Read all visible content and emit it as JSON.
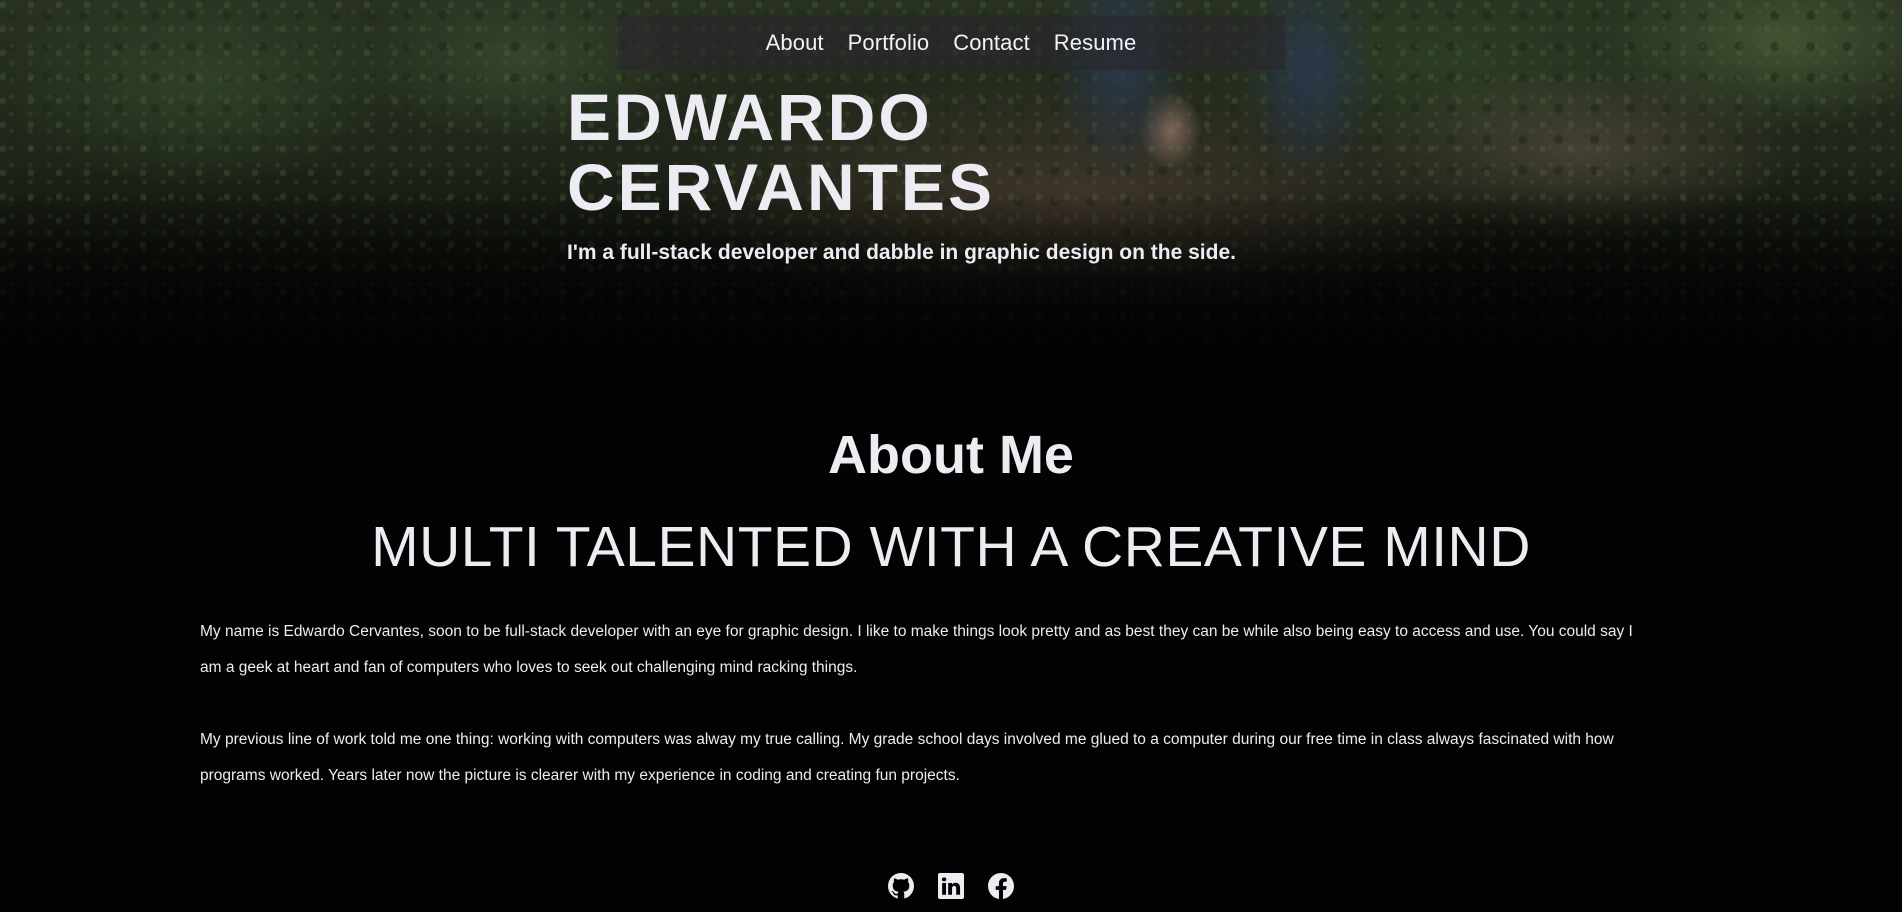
{
  "nav": {
    "items": [
      {
        "label": "About"
      },
      {
        "label": "Portfolio"
      },
      {
        "label": "Contact"
      },
      {
        "label": "Resume"
      }
    ]
  },
  "hero": {
    "title_line1": "EDWARDO",
    "title_line2": "CERVANTES",
    "subtitle": "I'm a full-stack developer and dabble in graphic design on the side."
  },
  "about": {
    "heading": "About Me",
    "tagline": "MULTI TALENTED WITH A CREATIVE MIND",
    "paragraphs": [
      "My name is Edwardo Cervantes, soon to be full-stack developer with an eye for graphic design. I like to make things look pretty and as best they can be while also being easy to access and use. You could say I am a geek at heart and fan of computers who loves to seek out challenging mind racking things.",
      "My previous line of work told me one thing: working with computers was alway my true calling. My grade school days involved me glued to a computer during our free time in class always fascinated with how programs worked. Years later now the picture is clearer with my experience in coding and creating fun projects."
    ]
  },
  "social": {
    "icons": [
      "github-icon",
      "linkedin-icon",
      "facebook-icon"
    ]
  },
  "colors": {
    "background": "#030304",
    "text": "#ececf2",
    "nav_bg": "rgba(40,38,44,0.62)"
  }
}
